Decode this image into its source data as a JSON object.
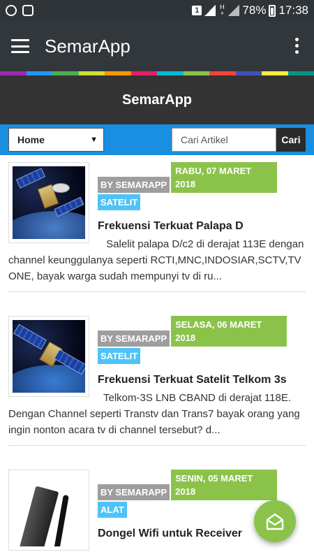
{
  "status_bar": {
    "battery": "78%",
    "time": "17:38",
    "sim": "1"
  },
  "app_bar": {
    "title": "SemarApp"
  },
  "stripe_colors": [
    "#9c27b0",
    "#2196f3",
    "#4caf50",
    "#cddc39",
    "#ff9800",
    "#e91e63",
    "#00bcd4",
    "#8bc34a",
    "#f44336",
    "#3f51b5",
    "#ffeb3b",
    "#009688"
  ],
  "site_header": {
    "title": "SemarApp"
  },
  "nav": {
    "select_value": "Home",
    "search_placeholder": "Cari Artikel",
    "search_button": "Cari"
  },
  "posts": [
    {
      "author": "BY SEMARAPP",
      "date": "RABU, 07 MARET 2018",
      "category": "SATELIT",
      "title": "Frekuensi Terkuat Palapa D",
      "excerpt": " Salelit palapa D/c2 di derajat 113E dengan channel keunggulanya seperti RCTI,MNC,INDOSIAR,SCTV,TV ONE, bayak warga sudah mempunyi tv di ru..."
    },
    {
      "author": "BY SEMARAPP",
      "date": "SELASA, 06 MARET 2018",
      "category": "SATELIT",
      "title": "Frekuensi Terkuat Satelit Telkom 3s",
      "excerpt": "Telkom-3S LNB CBAND di derajat 118E. Dengan Channel seperti Transtv dan Trans7 bayak orang yang ingin nonton acara tv di channel tersebut? d..."
    },
    {
      "author": "BY SEMARAPP",
      "date": "SENIN, 05 MARET 2018",
      "category": "ALAT",
      "title": "Dongel Wifi untuk Receiver",
      "excerpt": ""
    }
  ],
  "fab": {
    "icon": "envelope-open-icon",
    "color": "#8bc34a"
  }
}
